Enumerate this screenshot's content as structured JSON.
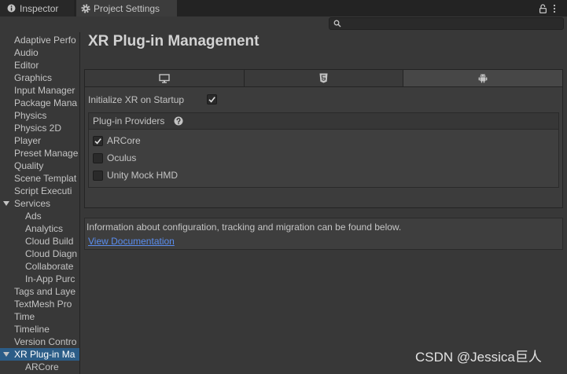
{
  "window_tabs": [
    {
      "label": "Inspector",
      "icon": "info-icon",
      "active": false
    },
    {
      "label": "Project Settings",
      "icon": "gear-icon",
      "active": true
    }
  ],
  "window_controls": {
    "lock_icon": "lock-icon",
    "menu_icon": "kebab-menu-icon"
  },
  "search": {
    "icon": "search-icon",
    "value": "",
    "placeholder": ""
  },
  "sidebar": {
    "items": [
      {
        "label": "Adaptive Perfo"
      },
      {
        "label": "Audio"
      },
      {
        "label": "Editor"
      },
      {
        "label": "Graphics"
      },
      {
        "label": "Input Manager"
      },
      {
        "label": "Package Mana"
      },
      {
        "label": "Physics"
      },
      {
        "label": "Physics 2D"
      },
      {
        "label": "Player"
      },
      {
        "label": "Preset Manage"
      },
      {
        "label": "Quality"
      },
      {
        "label": "Scene Templat"
      },
      {
        "label": "Script Executi"
      },
      {
        "label": "Services",
        "expanded": true,
        "children": [
          {
            "label": "Ads"
          },
          {
            "label": "Analytics"
          },
          {
            "label": "Cloud Build"
          },
          {
            "label": "Cloud Diagn"
          },
          {
            "label": "Collaborate"
          },
          {
            "label": "In-App Purc"
          }
        ]
      },
      {
        "label": "Tags and Laye"
      },
      {
        "label": "TextMesh Pro"
      },
      {
        "label": "Time"
      },
      {
        "label": "Timeline"
      },
      {
        "label": "Version Contro"
      },
      {
        "label": "XR Plug-in Ma",
        "expanded": true,
        "selected": true,
        "children": [
          {
            "label": "ARCore"
          }
        ]
      }
    ]
  },
  "main": {
    "title": "XR Plug-in Management",
    "platform_tabs": [
      {
        "icon": "desktop-icon",
        "selected": false
      },
      {
        "icon": "html5-icon",
        "selected": false
      },
      {
        "icon": "android-icon",
        "selected": true
      }
    ],
    "initialize_xr": {
      "label": "Initialize XR on Startup",
      "checked": true
    },
    "plugin_providers": {
      "header": "Plug-in Providers",
      "help_icon": "help-icon",
      "items": [
        {
          "label": "ARCore",
          "checked": true
        },
        {
          "label": "Oculus",
          "checked": false
        },
        {
          "label": "Unity Mock HMD",
          "checked": false
        }
      ]
    },
    "info": {
      "text": "Information about configuration, tracking and migration can be found below.",
      "link_label": "View Documentation"
    }
  },
  "watermark": "CSDN @Jessica巨人",
  "colors": {
    "background": "#383838",
    "tab_strip": "#232323",
    "selection": "#2c5d87",
    "link": "#5a8dee",
    "text": "#c4c4c4"
  }
}
